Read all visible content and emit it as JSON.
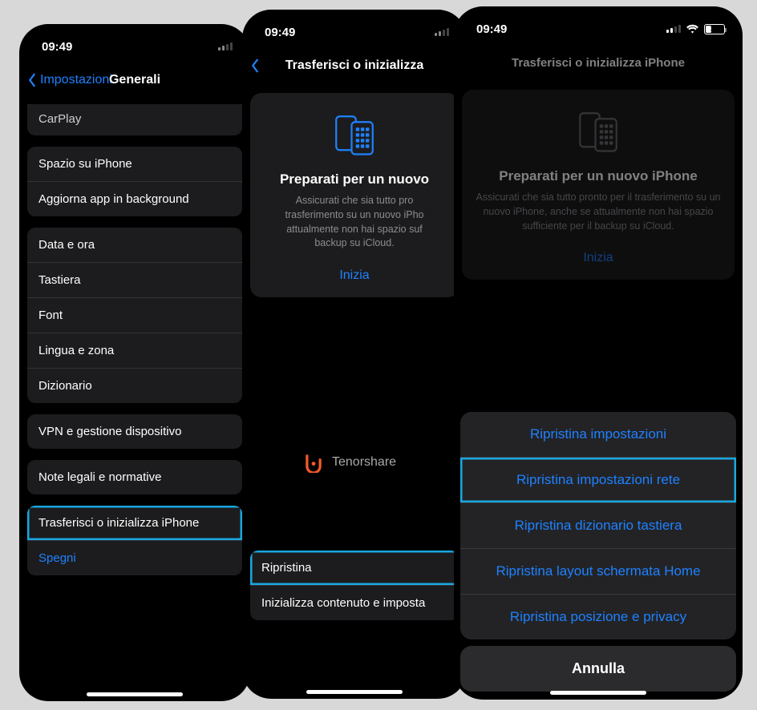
{
  "status": {
    "time": "09:49",
    "battery_pct": "31"
  },
  "screen1": {
    "back": "Impostazioni",
    "title": "Generali",
    "partial_row": "CarPlay",
    "group1": [
      "Spazio su iPhone",
      "Aggiorna app in background"
    ],
    "group2": [
      "Data e ora",
      "Tastiera",
      "Font",
      "Lingua e zona",
      "Dizionario"
    ],
    "group3": [
      "VPN e gestione dispositivo"
    ],
    "group4": [
      "Note legali e normative"
    ],
    "group5": {
      "transfer": "Trasferisci o inizializza iPhone",
      "shutdown": "Spegni"
    }
  },
  "screen2": {
    "title": "Trasferisci o inizializza",
    "card": {
      "heading": "Preparati per un nuovo",
      "body": "Assicurati che sia tutto pro\ntrasferimento su un nuovo iPho\nattualmente non hai spazio suf\nbackup su iCloud.",
      "start": "Inizia"
    },
    "reset": "Ripristina",
    "erase": "Inizializza contenuto e imposta"
  },
  "screen3": {
    "title": "Trasferisci o inizializza iPhone",
    "card": {
      "heading": "Preparati per un nuovo iPhone",
      "body": "Assicurati che sia tutto pronto per il trasferimento su un nuovo iPhone, anche se attualmente non hai spazio sufficiente per il backup su iCloud.",
      "start": "Inizia"
    },
    "sheet": {
      "options": [
        "Ripristina impostazioni",
        "Ripristina impostazioni rete",
        "Ripristina dizionario tastiera",
        "Ripristina layout schermata Home",
        "Ripristina posizione e privacy"
      ],
      "highlighted_index": 1,
      "cancel": "Annulla"
    }
  },
  "watermark": "Tenorshare"
}
